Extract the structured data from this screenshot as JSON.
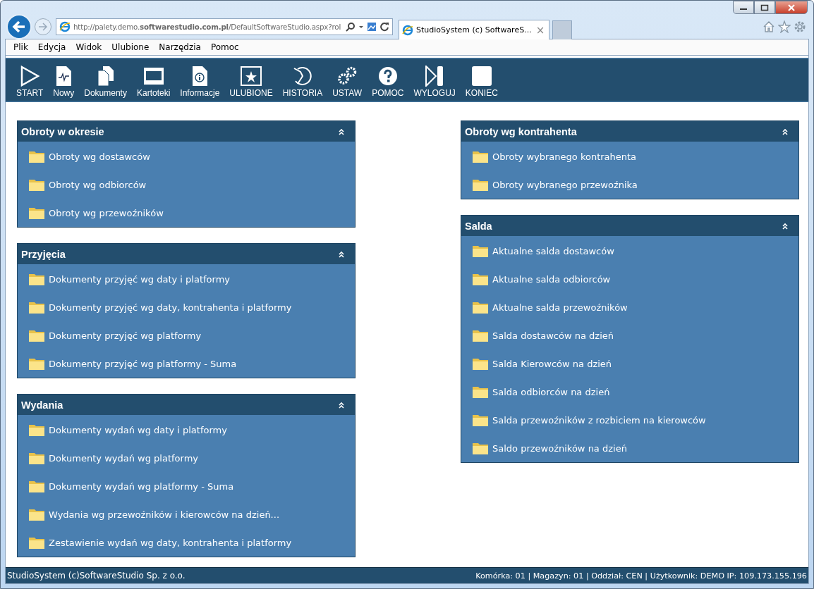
{
  "browser": {
    "address": "http://palety.demo.**softwarestudio.com.pl**/DefaultSoftwareStudio.aspx?rol",
    "tabs": [
      {
        "title": "StudioSystem (c) SoftwareS...",
        "close": "×",
        "selected": true
      }
    ]
  },
  "menu": [
    "Plik",
    "Edycja",
    "Widok",
    "Ulubione",
    "Narzędzia",
    "Pomoc"
  ],
  "toolbar": [
    {
      "kind": "play",
      "label": "START"
    },
    {
      "kind": "doc",
      "label": "Nowy"
    },
    {
      "kind": "docs",
      "label": "Dokumenty"
    },
    {
      "kind": "window",
      "label": "Kartoteki"
    },
    {
      "kind": "info",
      "label": "Informacje"
    },
    {
      "kind": "star",
      "label": "ULUBIONE"
    },
    {
      "kind": "history",
      "label": "HISTORIA"
    },
    {
      "kind": "gears",
      "label": "USTAW"
    },
    {
      "kind": "help",
      "label": "POMOC"
    },
    {
      "kind": "logout",
      "label": "WYLOGUJ"
    },
    {
      "kind": "stop",
      "label": "KONIEC"
    }
  ],
  "columns": [
    [
      {
        "title": "Obroty w okresie",
        "expanded": true,
        "items": [
          "Obroty wg dostawców",
          "Obroty wg odbiorców",
          "Obroty wg przewoźników"
        ]
      },
      {
        "title": "Przyjęcia",
        "expanded": true,
        "items": [
          "Dokumenty przyjęć wg daty i platformy",
          "Dokumenty przyjęć wg daty, kontrahenta i platformy",
          "Dokumenty przyjęć wg platformy",
          "Dokumenty przyjęć wg platformy - Suma"
        ]
      },
      {
        "title": "Wydania",
        "expanded": true,
        "items": [
          "Dokumenty wydań wg daty i platformy",
          "Dokumenty wydań wg platformy",
          "Dokumenty wydań wg platformy - Suma",
          "Wydania wg przewoźników i kierowców na dzień...",
          "Zestawienie wydań wg daty, kontrahenta i platformy"
        ]
      }
    ],
    [
      {
        "title": "Obroty wg kontrahenta",
        "expanded": true,
        "items": [
          "Obroty wybranego kontrahenta",
          "Obroty wybranego przewoźnika"
        ]
      },
      {
        "title": "Salda",
        "expanded": true,
        "items": [
          "Aktualne salda dostawców",
          "Aktualne salda odbiorców",
          "Aktualne salda przewoźników",
          "Salda dostawców na dzień",
          "Salda Kierowców na dzień",
          "Salda odbiorców na dzień",
          "Salda przewoźników z rozbiciem na kierowców",
          "Saldo przewoźników na dzień"
        ]
      }
    ]
  ],
  "status_bar": {
    "left": "StudioSystem (c)SoftwareStudio Sp. z o.o.",
    "right": "Komórka: 01 | Magazyn: 01 | Oddział: CEN | Użytkownik: DEMO IP: 109.173.155.196"
  }
}
